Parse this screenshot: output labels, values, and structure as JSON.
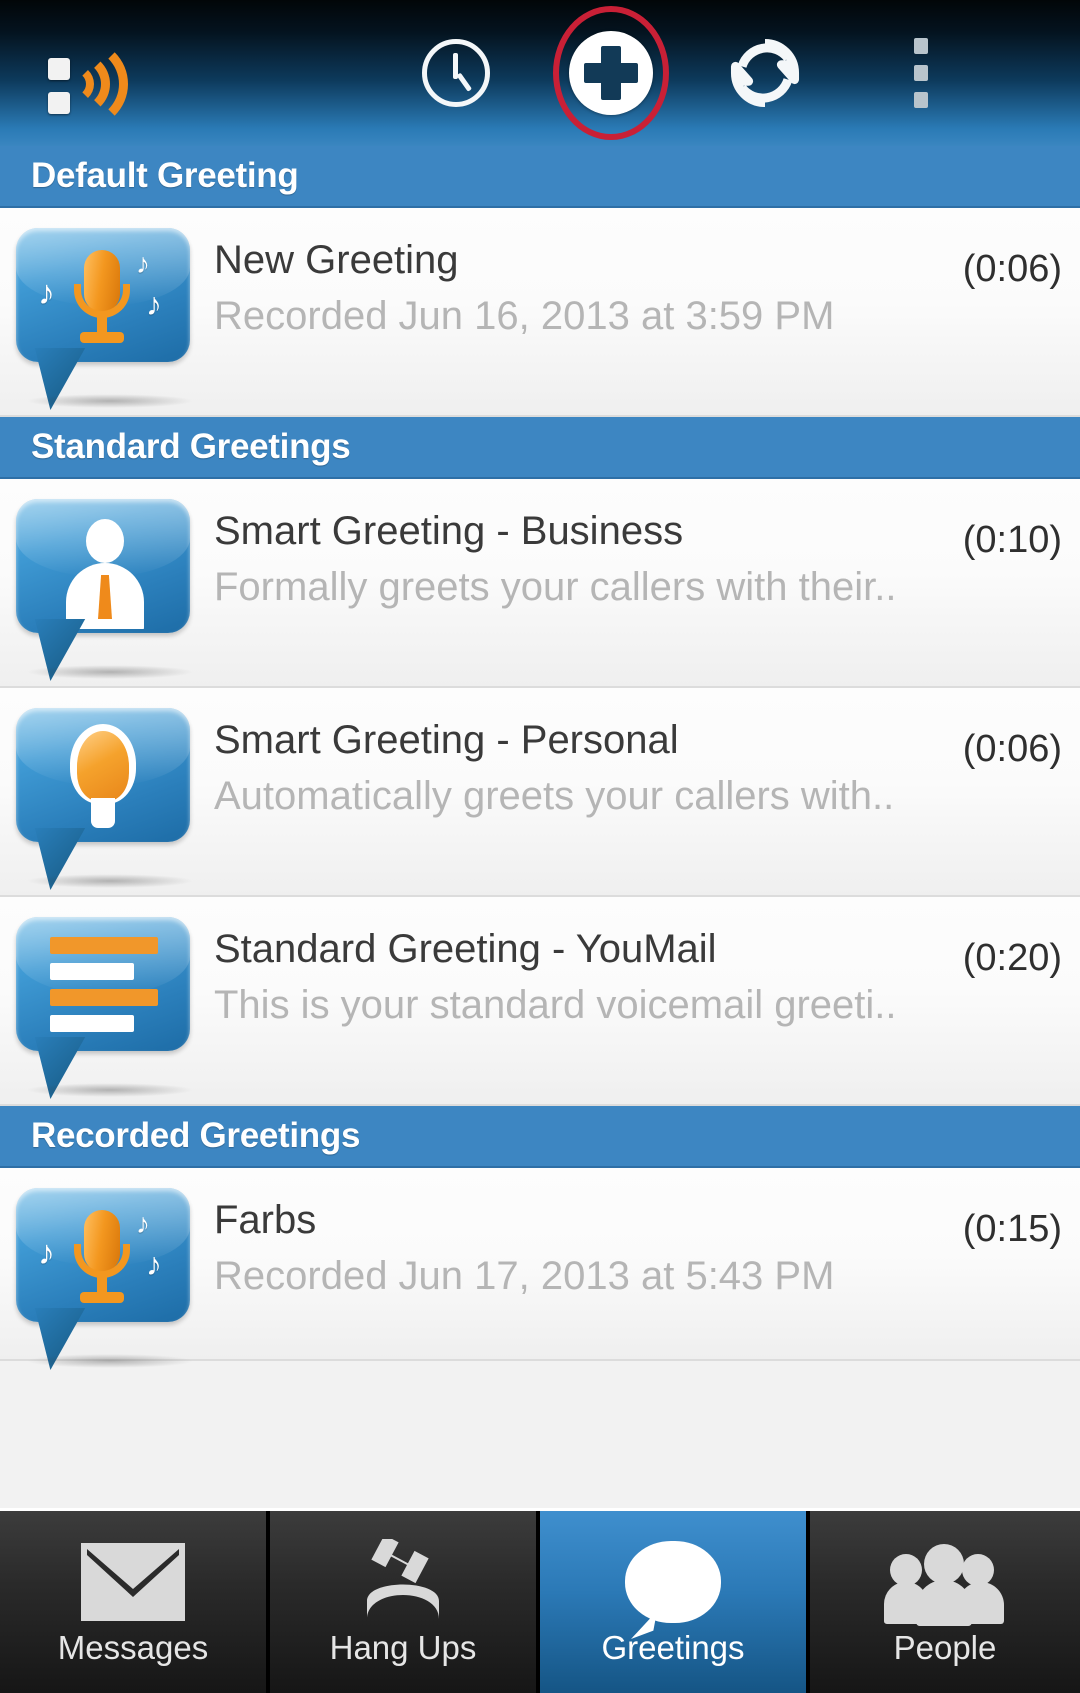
{
  "app": {
    "logo_icon": "youmail-wave-logo-icon"
  },
  "actionbar": {
    "clock_label": "Recent",
    "clock_icon": "clock-icon",
    "add_label": "Add Greeting",
    "add_icon": "plus-circle-icon",
    "sync_label": "Refresh",
    "sync_icon": "refresh-icon",
    "more_label": "More options",
    "more_icon": "overflow-menu-icon",
    "highlight_color": "#c92036"
  },
  "sections": [
    {
      "header": "Default Greeting",
      "items": [
        {
          "title": "New Greeting",
          "subtitle": "Recorded Jun 16, 2013 at 3:59 PM",
          "duration": "(0:06)",
          "icon": "microphone-bubble-icon"
        }
      ]
    },
    {
      "header": "Standard Greetings",
      "items": [
        {
          "title": "Smart Greeting - Business",
          "subtitle": "Formally greets your callers with their..",
          "duration": "(0:10)",
          "icon": "business-person-bubble-icon"
        },
        {
          "title": "Smart Greeting - Personal",
          "subtitle": "Automatically greets your callers with..",
          "duration": "(0:06)",
          "icon": "lightbulb-bubble-icon"
        },
        {
          "title": "Standard Greeting - YouMail",
          "subtitle": "This is your standard voicemail greeti..",
          "duration": "(0:20)",
          "icon": "text-lines-bubble-icon"
        }
      ]
    },
    {
      "header": "Recorded Greetings",
      "items": [
        {
          "title": "Farbs",
          "subtitle": "Recorded Jun 17, 2013 at 5:43 PM",
          "duration": "(0:15)",
          "icon": "microphone-bubble-icon"
        }
      ]
    }
  ],
  "tabbar": {
    "tabs": [
      {
        "label": "Messages",
        "icon": "envelope-icon",
        "active": false
      },
      {
        "label": "Hang Ups",
        "icon": "hangup-phone-icon",
        "active": false
      },
      {
        "label": "Greetings",
        "icon": "speech-bubble-icon",
        "active": true
      },
      {
        "label": "People",
        "icon": "people-group-icon",
        "active": false
      }
    ],
    "active_color": "#2b79b6"
  }
}
